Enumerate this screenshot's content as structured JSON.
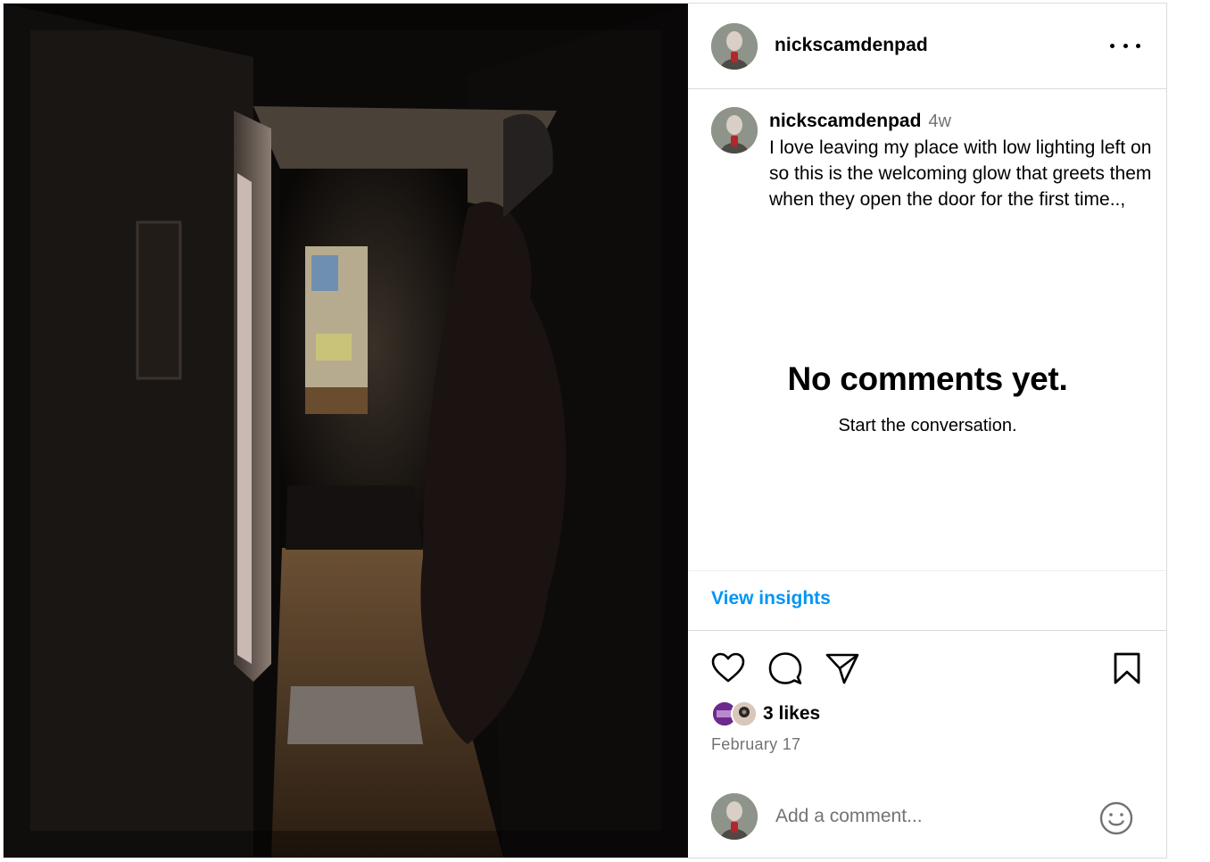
{
  "post": {
    "username": "nickscamdenpad",
    "more_icon": "more-horizontal-icon",
    "photo_alt": "Dim hallway looking toward a lit room",
    "caption": {
      "username": "nickscamdenpad",
      "time_ago": "4w",
      "text": "I love leaving my place with low lighting left on so this is the welcoming glow that greets them when they open the door for the first time..,"
    },
    "empty_state": {
      "title": "No comments yet.",
      "subtitle": "Start the conversation."
    },
    "insights_label": "View insights",
    "actions": {
      "like_icon": "heart-icon",
      "comment_icon": "comment-icon",
      "share_icon": "send-icon",
      "save_icon": "bookmark-icon"
    },
    "likes_text": "3 likes",
    "date": "February 17",
    "comment_box": {
      "placeholder": "Add a comment...",
      "emoji_icon": "emoji-icon"
    }
  }
}
